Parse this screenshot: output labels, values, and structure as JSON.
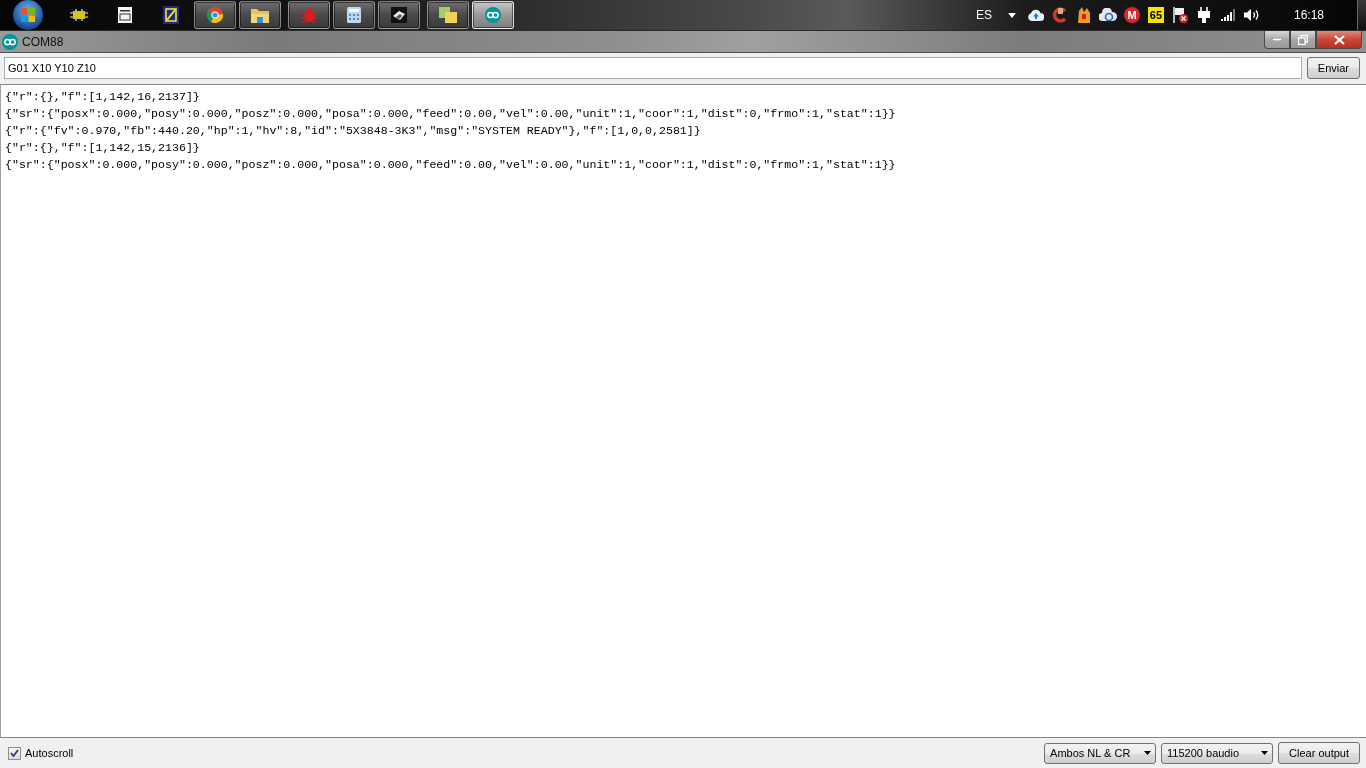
{
  "taskbar": {
    "windows": [
      {
        "selected": false
      },
      {
        "selected": false
      },
      {
        "selected": false
      },
      {
        "selected": false
      },
      {
        "selected": false
      },
      {
        "selected": false
      },
      {
        "selected": true
      }
    ],
    "tray": {
      "language": "ES",
      "app_letter": "M",
      "counter": "65",
      "clock": "16:18"
    }
  },
  "window": {
    "title": "COM88"
  },
  "send_bar": {
    "command": "G01 X10 Y10 Z10",
    "send_button": "Enviar"
  },
  "output": {
    "lines": [
      "{\"r\":{},\"f\":[1,142,16,2137]}",
      "{\"sr\":{\"posx\":0.000,\"posy\":0.000,\"posz\":0.000,\"posa\":0.000,\"feed\":0.00,\"vel\":0.00,\"unit\":1,\"coor\":1,\"dist\":0,\"frmo\":1,\"stat\":1}}",
      "{\"r\":{\"fv\":0.970,\"fb\":440.20,\"hp\":1,\"hv\":8,\"id\":\"5X3848-3K3\",\"msg\":\"SYSTEM READY\"},\"f\":[1,0,0,2581]}",
      "{\"r\":{},\"f\":[1,142,15,2136]}",
      "{\"sr\":{\"posx\":0.000,\"posy\":0.000,\"posz\":0.000,\"posa\":0.000,\"feed\":0.00,\"vel\":0.00,\"unit\":1,\"coor\":1,\"dist\":0,\"frmo\":1,\"stat\":1}}"
    ]
  },
  "footer": {
    "autoscroll": {
      "label": "Autoscroll",
      "checked": true
    },
    "line_ending": "Ambos NL & CR",
    "baud_rate": "115200 baudio",
    "clear_button": "Clear output"
  }
}
